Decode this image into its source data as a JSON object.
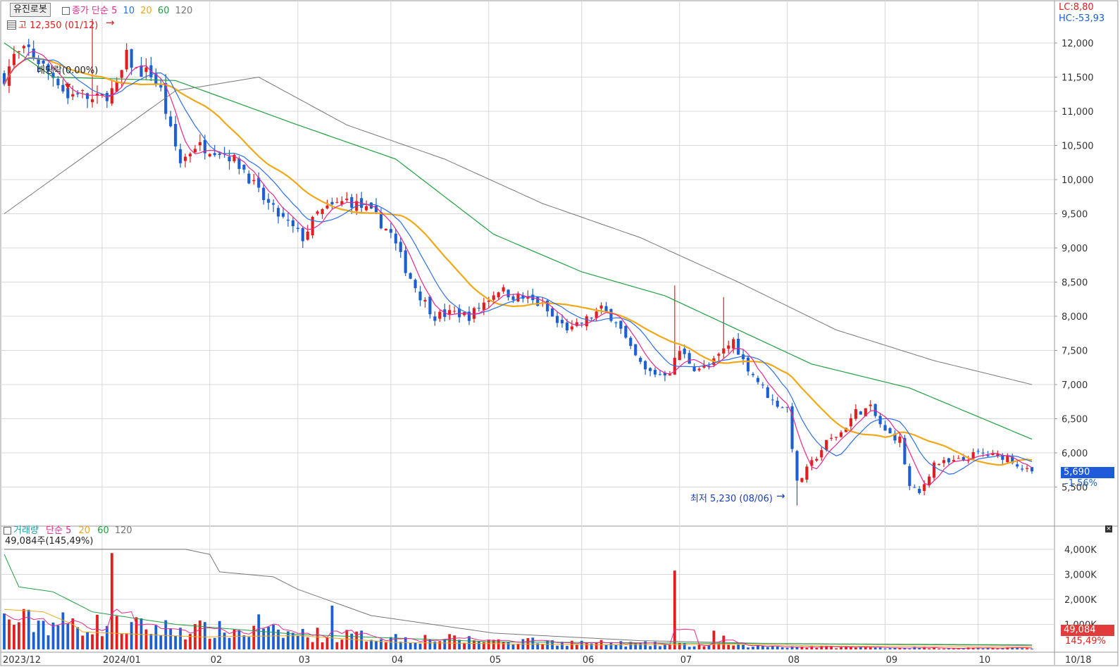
{
  "stock_name": "유진로봇",
  "legend": {
    "label": "종가 단순",
    "ma": [
      {
        "period": "5",
        "color": "#e8288e"
      },
      {
        "period": "10",
        "color": "#2c6fe8"
      },
      {
        "period": "20",
        "color": "#f0a818"
      },
      {
        "period": "60",
        "color": "#20a040"
      },
      {
        "period": "120",
        "color": "#777777"
      }
    ]
  },
  "volume_legend": {
    "label": "거래량",
    "label2": "단순",
    "ma": [
      {
        "period": "5",
        "color": "#e8288e"
      },
      {
        "period": "20",
        "color": "#f0a818"
      },
      {
        "period": "60",
        "color": "#20a040"
      },
      {
        "period": "120",
        "color": "#777777"
      }
    ]
  },
  "annotations": {
    "high": "고 12,350 (01/12)",
    "low": "최저 5,230 (08/06)",
    "dividend": "배당락(0.00%)",
    "volume_info": "49,084주(145,49%)"
  },
  "indicators": {
    "lc": "LC:8,80",
    "hc": "HC:-53,93"
  },
  "current": {
    "price": "5,690",
    "change": "-1.56%",
    "volume": "49,084",
    "volume_pct": "145,49%"
  },
  "x_labels": [
    "2023/12",
    "2024/01",
    "02",
    "03",
    "04",
    "05",
    "06",
    "07",
    "08",
    "09",
    "10",
    "10/18"
  ],
  "colors": {
    "up": "#e02020",
    "down": "#1c5fd0",
    "grid": "#d8d8d8",
    "axis": "#888888"
  },
  "chart_data": {
    "type": "candlestick",
    "ylim": [
      5000,
      12500
    ],
    "y_ticks": [
      "12,000",
      "11,500",
      "11,000",
      "10,500",
      "10,000",
      "9,500",
      "9,000",
      "8,500",
      "8,000",
      "7,500",
      "7,000",
      "6,500",
      "6,000",
      "5,500"
    ],
    "volume_ylim": [
      0,
      4500
    ],
    "volume_ticks": [
      "4,000K",
      "3,000K",
      "2,000K",
      "1,000K"
    ],
    "month_starts": [
      0,
      20,
      42,
      60,
      79,
      99,
      118,
      138,
      160,
      180,
      199
    ],
    "num_days": 211,
    "anchors": [
      [
        0,
        11500
      ],
      [
        2,
        11800
      ],
      [
        5,
        11900
      ],
      [
        8,
        11650
      ],
      [
        11,
        11450
      ],
      [
        13,
        11200
      ],
      [
        15,
        11300
      ],
      [
        18,
        11150
      ],
      [
        20,
        11200
      ],
      [
        23,
        11350
      ],
      [
        25,
        11800
      ],
      [
        27,
        11600
      ],
      [
        30,
        11550
      ],
      [
        32,
        11300
      ],
      [
        34,
        10700
      ],
      [
        36,
        10250
      ],
      [
        39,
        10500
      ],
      [
        43,
        10450
      ],
      [
        46,
        10350
      ],
      [
        49,
        10150
      ],
      [
        52,
        9800
      ],
      [
        55,
        9550
      ],
      [
        58,
        9350
      ],
      [
        61,
        9150
      ],
      [
        64,
        9500
      ],
      [
        67,
        9600
      ],
      [
        70,
        9700
      ],
      [
        73,
        9600
      ],
      [
        76,
        9450
      ],
      [
        79,
        9200
      ],
      [
        82,
        8700
      ],
      [
        85,
        8300
      ],
      [
        88,
        8000
      ],
      [
        92,
        8050
      ],
      [
        95,
        8000
      ],
      [
        98,
        8200
      ],
      [
        101,
        8400
      ],
      [
        104,
        8300
      ],
      [
        107,
        8250
      ],
      [
        110,
        8150
      ],
      [
        113,
        7900
      ],
      [
        116,
        7800
      ],
      [
        119,
        7950
      ],
      [
        122,
        8100
      ],
      [
        125,
        7950
      ],
      [
        128,
        7500
      ],
      [
        131,
        7200
      ],
      [
        134,
        7150
      ],
      [
        136,
        7200
      ],
      [
        138,
        7500
      ],
      [
        141,
        7250
      ],
      [
        144,
        7250
      ],
      [
        147,
        7500
      ],
      [
        149,
        7650
      ],
      [
        151,
        7350
      ],
      [
        154,
        7050
      ],
      [
        157,
        6750
      ],
      [
        160,
        6650
      ],
      [
        162,
        5550
      ],
      [
        165,
        5850
      ],
      [
        168,
        6150
      ],
      [
        171,
        6300
      ],
      [
        174,
        6600
      ],
      [
        177,
        6650
      ],
      [
        180,
        6300
      ],
      [
        183,
        6200
      ],
      [
        185,
        5500
      ],
      [
        187,
        5400
      ],
      [
        190,
        5850
      ],
      [
        193,
        5850
      ],
      [
        196,
        5900
      ],
      [
        199,
        6000
      ],
      [
        202,
        5950
      ],
      [
        205,
        5950
      ],
      [
        208,
        5780
      ],
      [
        210,
        5690
      ]
    ],
    "volume_spikes": {
      "22": 3850,
      "52": 1400,
      "67": 1750,
      "137": 3150,
      "107": 450,
      "145": 750,
      "147": 550
    },
    "ma120_anchors": [
      [
        0,
        9500
      ],
      [
        35,
        11300
      ],
      [
        52,
        11500
      ],
      [
        70,
        10800
      ],
      [
        90,
        10300
      ],
      [
        110,
        9650
      ],
      [
        130,
        9150
      ],
      [
        150,
        8500
      ],
      [
        170,
        7800
      ],
      [
        190,
        7350
      ],
      [
        210,
        7000
      ]
    ],
    "ma60_anchors": [
      [
        0,
        12000
      ],
      [
        10,
        11500
      ],
      [
        35,
        11450
      ],
      [
        60,
        10800
      ],
      [
        80,
        10300
      ],
      [
        100,
        9200
      ],
      [
        118,
        8650
      ],
      [
        135,
        8300
      ],
      [
        150,
        7800
      ],
      [
        165,
        7300
      ],
      [
        185,
        6950
      ],
      [
        210,
        6200
      ]
    ],
    "volume_ma120_anchors": [
      [
        0,
        4000
      ],
      [
        37,
        4000
      ],
      [
        42,
        3800
      ],
      [
        44,
        3100
      ],
      [
        55,
        2900
      ],
      [
        60,
        2400
      ],
      [
        75,
        1350
      ],
      [
        100,
        650
      ],
      [
        130,
        350
      ],
      [
        160,
        220
      ],
      [
        210,
        160
      ]
    ],
    "volume_ma60_anchors": [
      [
        0,
        3800
      ],
      [
        3,
        2500
      ],
      [
        10,
        2300
      ],
      [
        18,
        1500
      ],
      [
        35,
        1000
      ],
      [
        60,
        600
      ],
      [
        100,
        300
      ],
      [
        140,
        250
      ],
      [
        210,
        180
      ]
    ],
    "volume_ma20_anchors": [
      [
        0,
        1600
      ],
      [
        8,
        1500
      ],
      [
        14,
        1000
      ],
      [
        16,
        700
      ],
      [
        40,
        500
      ],
      [
        60,
        550
      ],
      [
        80,
        280
      ],
      [
        120,
        180
      ],
      [
        150,
        200
      ],
      [
        170,
        130
      ],
      [
        210,
        100
      ]
    ]
  }
}
